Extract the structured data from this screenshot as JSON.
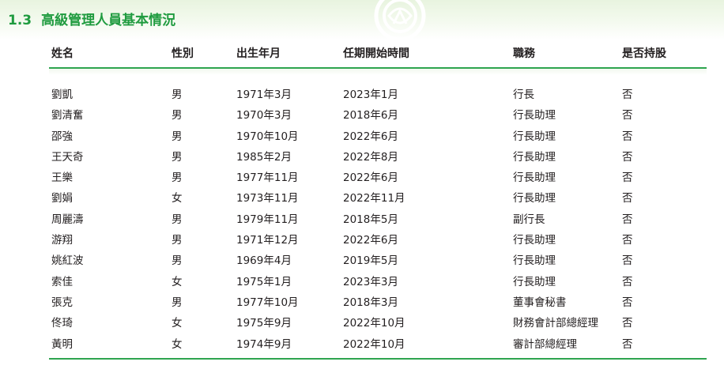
{
  "section": {
    "number": "1.3",
    "title": "高級管理人員基本情況"
  },
  "columns": [
    "姓名",
    "性別",
    "出生年月",
    "任期開始時間",
    "職務",
    "是否持股"
  ],
  "rows": [
    [
      "劉凱",
      "男",
      "1971年3月",
      "2023年1月",
      "行長",
      "否"
    ],
    [
      "劉清奮",
      "男",
      "1970年3月",
      "2018年6月",
      "行長助理",
      "否"
    ],
    [
      "邵強",
      "男",
      "1970年10月",
      "2022年6月",
      "行長助理",
      "否"
    ],
    [
      "王天奇",
      "男",
      "1985年2月",
      "2022年8月",
      "行長助理",
      "否"
    ],
    [
      "王樂",
      "男",
      "1977年11月",
      "2022年6月",
      "行長助理",
      "否"
    ],
    [
      "劉娟",
      "女",
      "1973年11月",
      "2022年11月",
      "行長助理",
      "否"
    ],
    [
      "周麗濤",
      "男",
      "1979年11月",
      "2018年5月",
      "副行長",
      "否"
    ],
    [
      "游翔",
      "男",
      "1971年12月",
      "2022年6月",
      "行長助理",
      "否"
    ],
    [
      "姚紅波",
      "男",
      "1969年4月",
      "2019年5月",
      "行長助理",
      "否"
    ],
    [
      "索佳",
      "女",
      "1975年1月",
      "2023年3月",
      "行長助理",
      "否"
    ],
    [
      "張克",
      "男",
      "1977年10月",
      "2018年3月",
      "董事會秘書",
      "否"
    ],
    [
      "佟琦",
      "女",
      "1975年9月",
      "2022年10月",
      "財務會計部總經理",
      "否"
    ],
    [
      "黃明",
      "女",
      "1974年9月",
      "2022年10月",
      "審計部總經理",
      "否"
    ]
  ],
  "colors": {
    "accent": "#1f9b3f",
    "rule": "#2ea44f",
    "band": "#e8f4df"
  }
}
